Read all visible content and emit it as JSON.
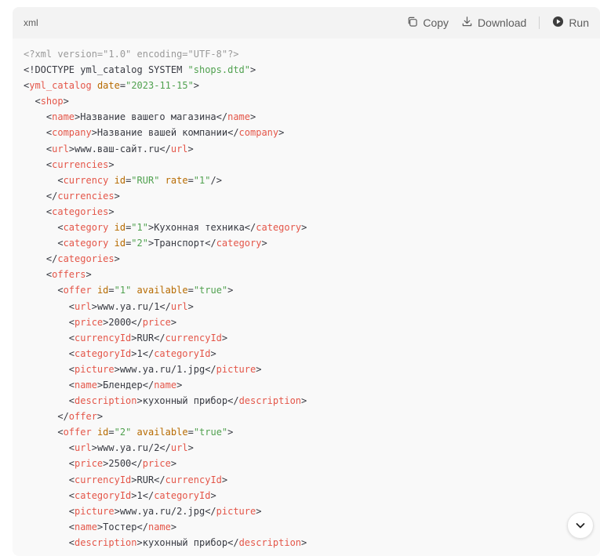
{
  "code_block": {
    "language": "xml",
    "copy_label": "Copy",
    "download_label": "Download",
    "run_label": "Run",
    "lines": [
      [
        [
          "c",
          "<?xml version=\"1.0\" encoding=\"UTF-8\"?>"
        ]
      ],
      [
        [
          "p",
          "<!DOCTYPE yml_catalog SYSTEM "
        ],
        [
          "s",
          "\"shops.dtd\""
        ],
        [
          "p",
          ">"
        ]
      ],
      [
        [
          "p",
          "<"
        ],
        [
          "t",
          "yml_catalog"
        ],
        [
          "p",
          " "
        ],
        [
          "a",
          "date"
        ],
        [
          "p",
          "="
        ],
        [
          "s",
          "\"2023-11-15\""
        ],
        [
          "p",
          ">"
        ]
      ],
      [
        [
          "p",
          "  <"
        ],
        [
          "t",
          "shop"
        ],
        [
          "p",
          ">"
        ]
      ],
      [
        [
          "p",
          "    <"
        ],
        [
          "t",
          "name"
        ],
        [
          "p",
          ">Название вашего магазина</"
        ],
        [
          "t",
          "name"
        ],
        [
          "p",
          ">"
        ]
      ],
      [
        [
          "p",
          "    <"
        ],
        [
          "t",
          "company"
        ],
        [
          "p",
          ">Название вашей компании</"
        ],
        [
          "t",
          "company"
        ],
        [
          "p",
          ">"
        ]
      ],
      [
        [
          "p",
          "    <"
        ],
        [
          "t",
          "url"
        ],
        [
          "p",
          ">www.ваш-сайт.ru</"
        ],
        [
          "t",
          "url"
        ],
        [
          "p",
          ">"
        ]
      ],
      [
        [
          "p",
          "    <"
        ],
        [
          "t",
          "currencies"
        ],
        [
          "p",
          ">"
        ]
      ],
      [
        [
          "p",
          "      <"
        ],
        [
          "t",
          "currency"
        ],
        [
          "p",
          " "
        ],
        [
          "a",
          "id"
        ],
        [
          "p",
          "="
        ],
        [
          "s",
          "\"RUR\""
        ],
        [
          "p",
          " "
        ],
        [
          "a",
          "rate"
        ],
        [
          "p",
          "="
        ],
        [
          "s",
          "\"1\""
        ],
        [
          "p",
          "/>"
        ]
      ],
      [
        [
          "p",
          "    </"
        ],
        [
          "t",
          "currencies"
        ],
        [
          "p",
          ">"
        ]
      ],
      [
        [
          "p",
          "    <"
        ],
        [
          "t",
          "categories"
        ],
        [
          "p",
          ">"
        ]
      ],
      [
        [
          "p",
          "      <"
        ],
        [
          "t",
          "category"
        ],
        [
          "p",
          " "
        ],
        [
          "a",
          "id"
        ],
        [
          "p",
          "="
        ],
        [
          "s",
          "\"1\""
        ],
        [
          "p",
          ">Кухонная техника</"
        ],
        [
          "t",
          "category"
        ],
        [
          "p",
          ">"
        ]
      ],
      [
        [
          "p",
          "      <"
        ],
        [
          "t",
          "category"
        ],
        [
          "p",
          " "
        ],
        [
          "a",
          "id"
        ],
        [
          "p",
          "="
        ],
        [
          "s",
          "\"2\""
        ],
        [
          "p",
          ">Транспорт</"
        ],
        [
          "t",
          "category"
        ],
        [
          "p",
          ">"
        ]
      ],
      [
        [
          "p",
          "    </"
        ],
        [
          "t",
          "categories"
        ],
        [
          "p",
          ">"
        ]
      ],
      [
        [
          "p",
          "    <"
        ],
        [
          "t",
          "offers"
        ],
        [
          "p",
          ">"
        ]
      ],
      [
        [
          "p",
          "      <"
        ],
        [
          "t",
          "offer"
        ],
        [
          "p",
          " "
        ],
        [
          "a",
          "id"
        ],
        [
          "p",
          "="
        ],
        [
          "s",
          "\"1\""
        ],
        [
          "p",
          " "
        ],
        [
          "a",
          "available"
        ],
        [
          "p",
          "="
        ],
        [
          "s",
          "\"true\""
        ],
        [
          "p",
          ">"
        ]
      ],
      [
        [
          "p",
          "        <"
        ],
        [
          "t",
          "url"
        ],
        [
          "p",
          ">www.ya.ru/1</"
        ],
        [
          "t",
          "url"
        ],
        [
          "p",
          ">"
        ]
      ],
      [
        [
          "p",
          "        <"
        ],
        [
          "t",
          "price"
        ],
        [
          "p",
          ">2000</"
        ],
        [
          "t",
          "price"
        ],
        [
          "p",
          ">"
        ]
      ],
      [
        [
          "p",
          "        <"
        ],
        [
          "t",
          "currencyId"
        ],
        [
          "p",
          ">RUR</"
        ],
        [
          "t",
          "currencyId"
        ],
        [
          "p",
          ">"
        ]
      ],
      [
        [
          "p",
          "        <"
        ],
        [
          "t",
          "categoryId"
        ],
        [
          "p",
          ">1</"
        ],
        [
          "t",
          "categoryId"
        ],
        [
          "p",
          ">"
        ]
      ],
      [
        [
          "p",
          "        <"
        ],
        [
          "t",
          "picture"
        ],
        [
          "p",
          ">www.ya.ru/1.jpg</"
        ],
        [
          "t",
          "picture"
        ],
        [
          "p",
          ">"
        ]
      ],
      [
        [
          "p",
          "        <"
        ],
        [
          "t",
          "name"
        ],
        [
          "p",
          ">Блендер</"
        ],
        [
          "t",
          "name"
        ],
        [
          "p",
          ">"
        ]
      ],
      [
        [
          "p",
          "        <"
        ],
        [
          "t",
          "description"
        ],
        [
          "p",
          ">кухонный прибор</"
        ],
        [
          "t",
          "description"
        ],
        [
          "p",
          ">"
        ]
      ],
      [
        [
          "p",
          "      </"
        ],
        [
          "t",
          "offer"
        ],
        [
          "p",
          ">"
        ]
      ],
      [
        [
          "p",
          "      <"
        ],
        [
          "t",
          "offer"
        ],
        [
          "p",
          " "
        ],
        [
          "a",
          "id"
        ],
        [
          "p",
          "="
        ],
        [
          "s",
          "\"2\""
        ],
        [
          "p",
          " "
        ],
        [
          "a",
          "available"
        ],
        [
          "p",
          "="
        ],
        [
          "s",
          "\"true\""
        ],
        [
          "p",
          ">"
        ]
      ],
      [
        [
          "p",
          "        <"
        ],
        [
          "t",
          "url"
        ],
        [
          "p",
          ">www.ya.ru/2</"
        ],
        [
          "t",
          "url"
        ],
        [
          "p",
          ">"
        ]
      ],
      [
        [
          "p",
          "        <"
        ],
        [
          "t",
          "price"
        ],
        [
          "p",
          ">2500</"
        ],
        [
          "t",
          "price"
        ],
        [
          "p",
          ">"
        ]
      ],
      [
        [
          "p",
          "        <"
        ],
        [
          "t",
          "currencyId"
        ],
        [
          "p",
          ">RUR</"
        ],
        [
          "t",
          "currencyId"
        ],
        [
          "p",
          ">"
        ]
      ],
      [
        [
          "p",
          "        <"
        ],
        [
          "t",
          "categoryId"
        ],
        [
          "p",
          ">1</"
        ],
        [
          "t",
          "categoryId"
        ],
        [
          "p",
          ">"
        ]
      ],
      [
        [
          "p",
          "        <"
        ],
        [
          "t",
          "picture"
        ],
        [
          "p",
          ">www.ya.ru/2.jpg</"
        ],
        [
          "t",
          "picture"
        ],
        [
          "p",
          ">"
        ]
      ],
      [
        [
          "p",
          "        <"
        ],
        [
          "t",
          "name"
        ],
        [
          "p",
          ">Тостер</"
        ],
        [
          "t",
          "name"
        ],
        [
          "p",
          ">"
        ]
      ],
      [
        [
          "p",
          "        <"
        ],
        [
          "t",
          "description"
        ],
        [
          "p",
          ">кухонный прибор</"
        ],
        [
          "t",
          "description"
        ],
        [
          "p",
          ">"
        ]
      ]
    ]
  },
  "icons": {
    "copy": "copy-icon",
    "download": "download-icon",
    "run": "play-circle-icon",
    "scroll_down": "chevron-down-icon"
  },
  "colors": {
    "tag": "#e45649",
    "attribute": "#b76b01",
    "string": "#50a14f",
    "comment": "#9a9a9a",
    "text": "#383a42"
  }
}
